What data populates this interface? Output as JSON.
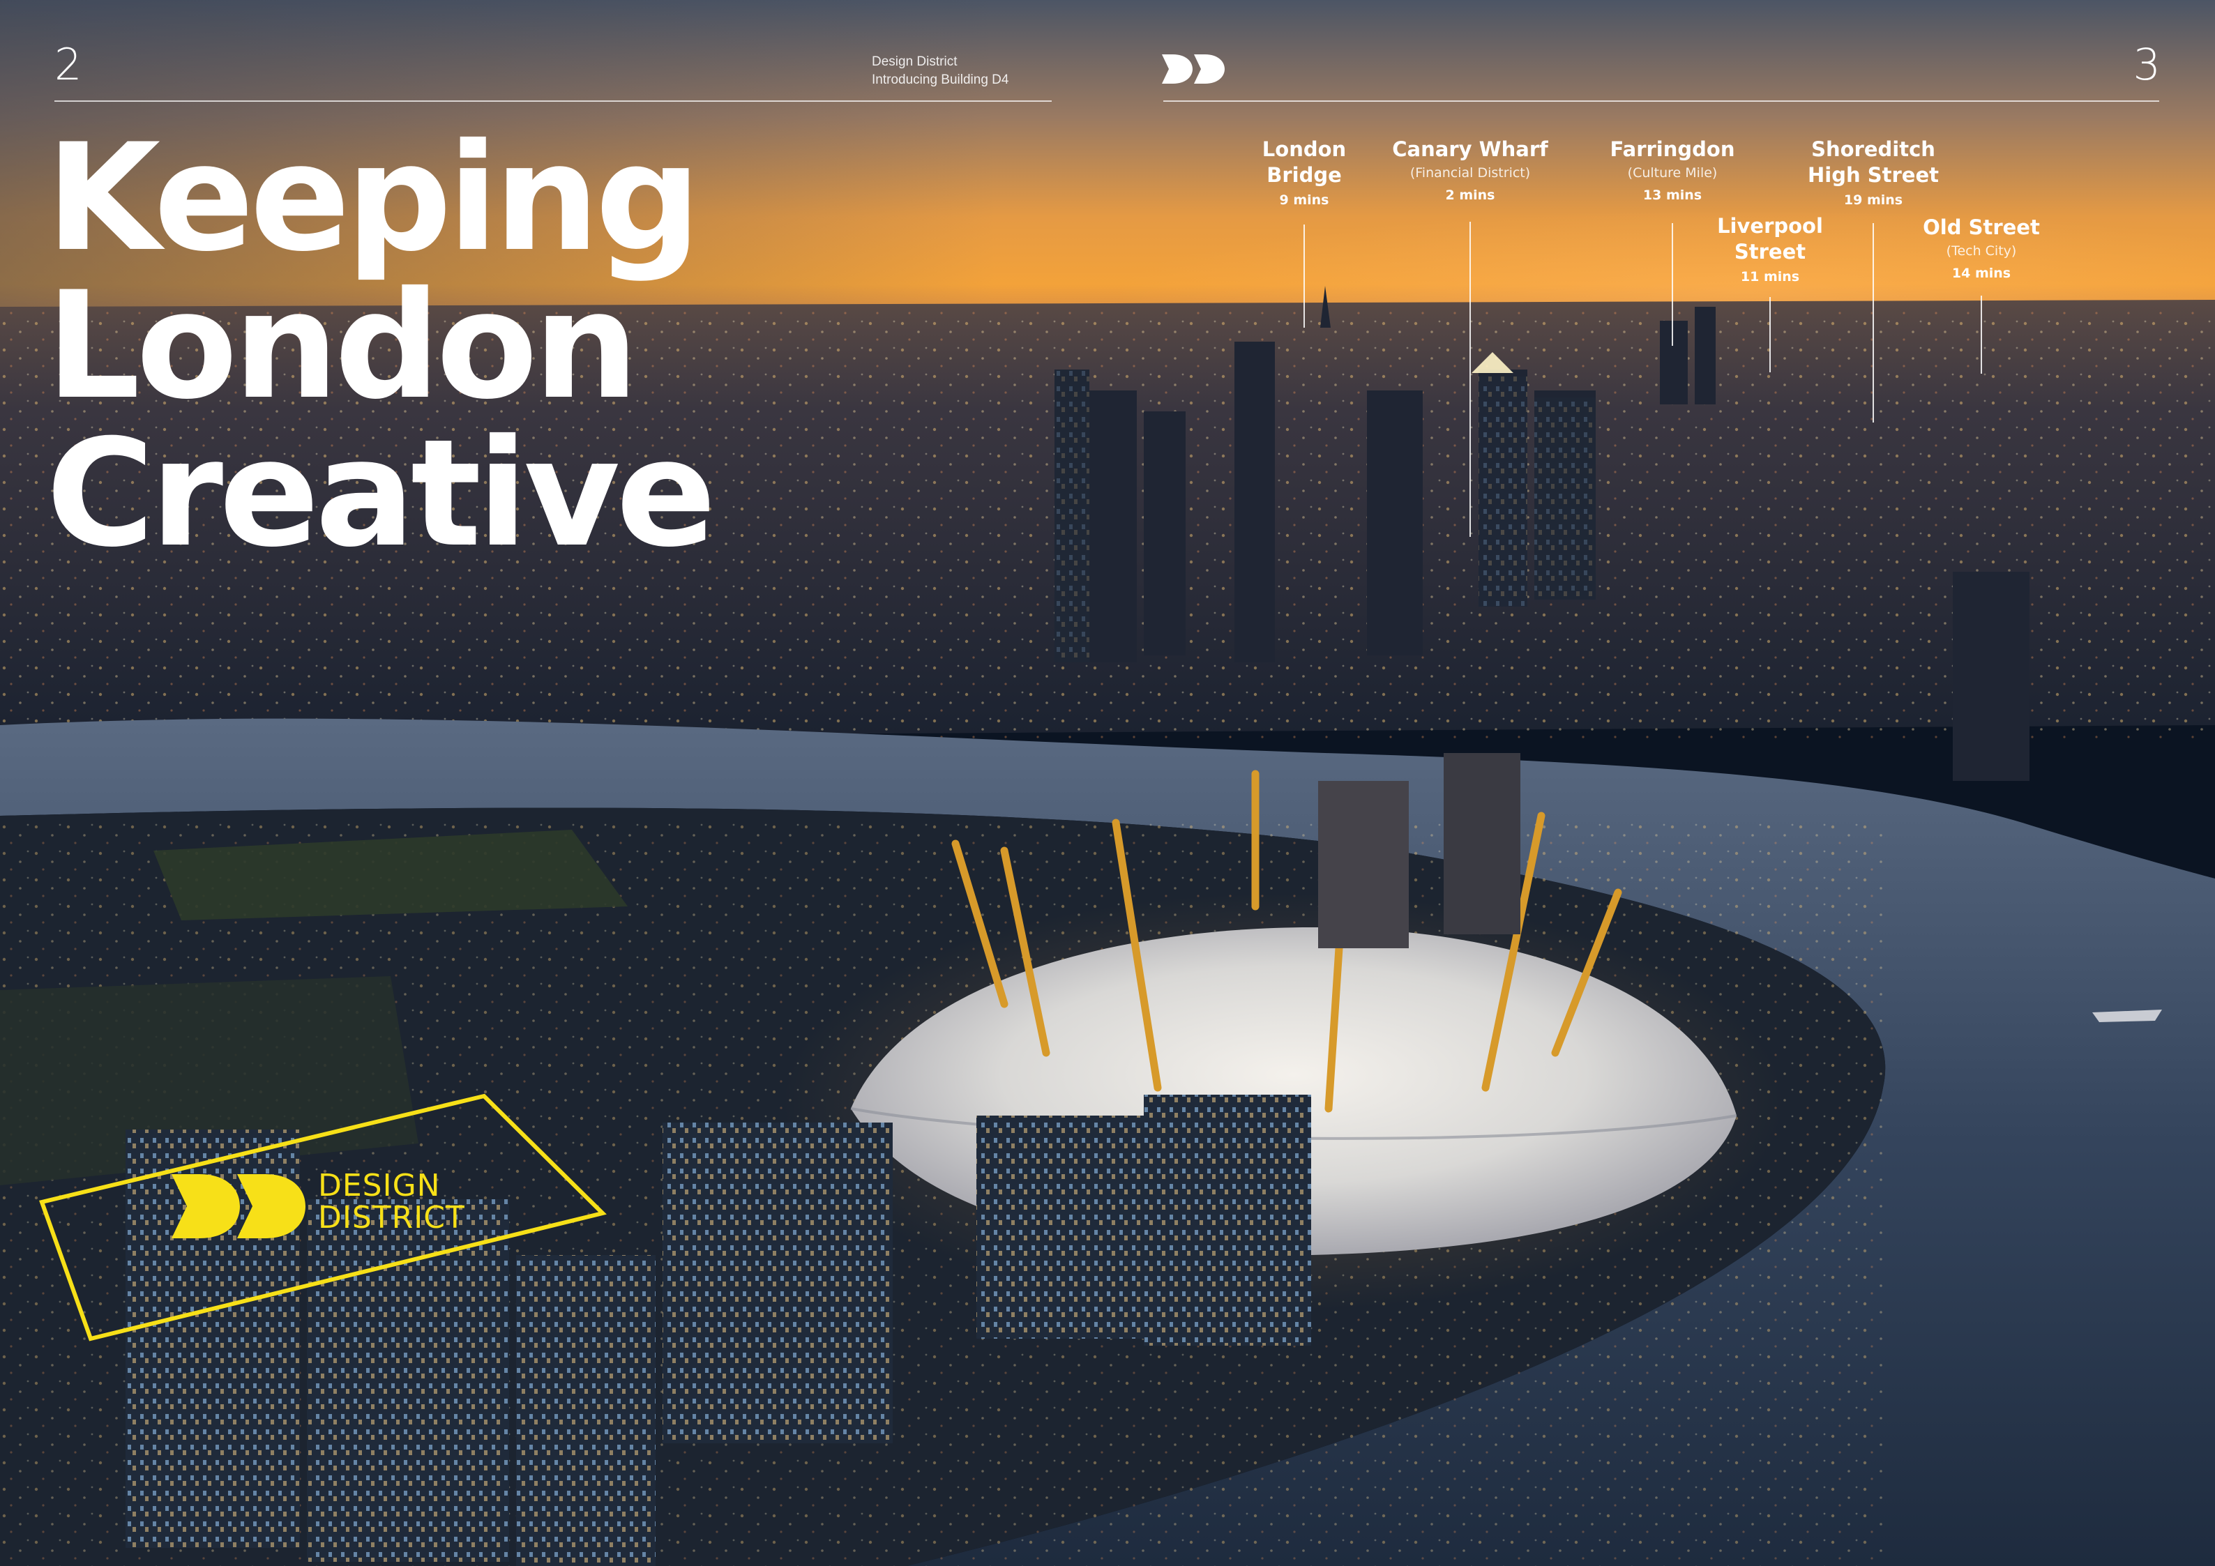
{
  "pages": {
    "left_number": "2",
    "right_number": "3"
  },
  "running_header": {
    "line1": "Design District",
    "line2": "Introducing Building D4"
  },
  "headline": {
    "line1": "Keeping",
    "line2": "London",
    "line3": "Creative"
  },
  "locations": [
    {
      "name_lines": [
        "London",
        "Bridge"
      ],
      "sub": "",
      "time": "9 mins"
    },
    {
      "name_lines": [
        "Canary Wharf"
      ],
      "sub": "(Financial District)",
      "time": "2 mins"
    },
    {
      "name_lines": [
        "Farringdon"
      ],
      "sub": "(Culture Mile)",
      "time": "13 mins"
    },
    {
      "name_lines": [
        "Shoreditch",
        "High Street"
      ],
      "sub": "",
      "time": "19 mins"
    },
    {
      "name_lines": [
        "Liverpool",
        "Street"
      ],
      "sub": "",
      "time": "11 mins"
    },
    {
      "name_lines": [
        "Old Street"
      ],
      "sub": "(Tech City)",
      "time": "14 mins"
    }
  ],
  "logo": {
    "line1": "DESIGN",
    "line2": "DISTRICT"
  },
  "colors": {
    "brand_yellow": "#f7e018",
    "text": "#ffffff",
    "rule": "#ffffff"
  },
  "icons": {
    "mark": "dd-monogram-icon"
  }
}
